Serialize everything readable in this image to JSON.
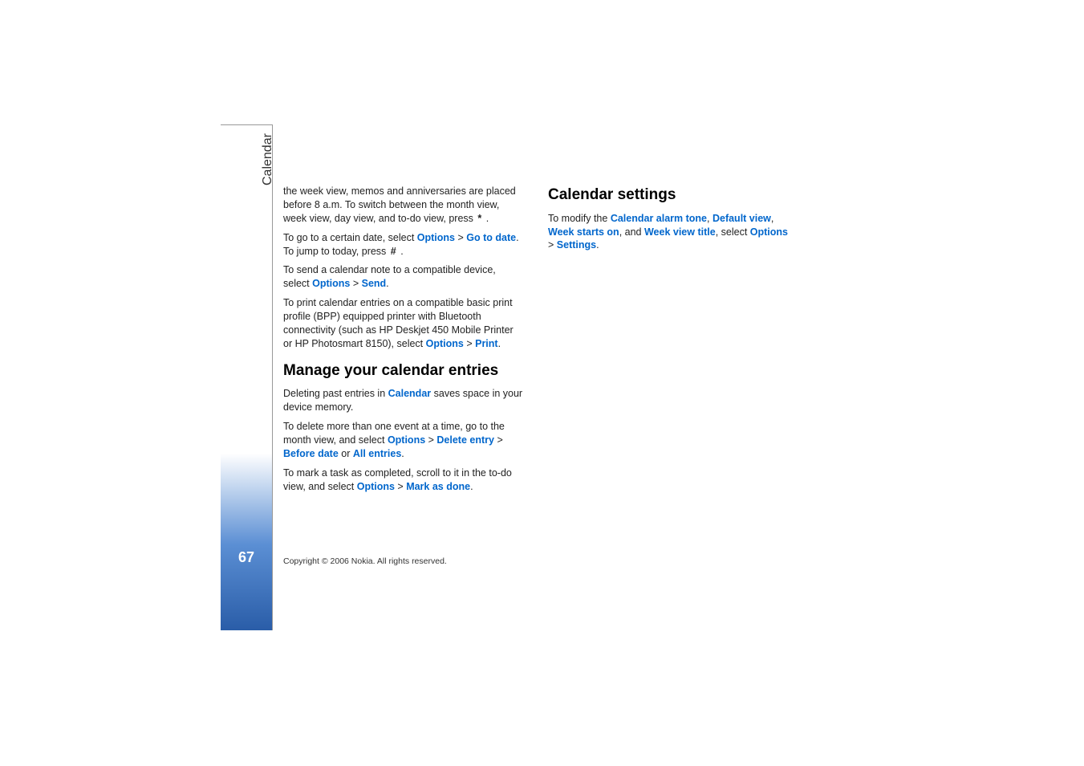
{
  "sidebar": {
    "label": "Calendar",
    "page_number": "67"
  },
  "col1": {
    "p1_a": "the week view, memos and anniversaries are placed before 8 a.m. To switch between the month view, week view, day view, and to-do view, press ",
    "p1_key": "*",
    "p1_b": " .",
    "p2_a": "To go to a certain date, select ",
    "p2_l1": "Options",
    "p2_gt": " > ",
    "p2_l2": "Go to date",
    "p2_b": ". To jump to today, press ",
    "p2_key": "#",
    "p2_c": " .",
    "p3_a": "To send a calendar note to a compatible device, select ",
    "p3_l1": "Options",
    "p3_gt": " > ",
    "p3_l2": "Send",
    "p3_b": ".",
    "p4_a": "To print calendar entries on a compatible basic print profile (BPP) equipped printer with Bluetooth connectivity (such as HP Deskjet 450 Mobile Printer or HP Photosmart 8150), select ",
    "p4_l1": "Options",
    "p4_gt": " > ",
    "p4_l2": "Print",
    "p4_b": ".",
    "h1": "Manage your calendar entries",
    "p5_a": "Deleting past entries in ",
    "p5_l1": "Calendar",
    "p5_b": " saves space in your device memory.",
    "p6_a": "To delete more than one event at a time, go to the month view, and select ",
    "p6_l1": "Options",
    "p6_gt1": " > ",
    "p6_l2": "Delete entry",
    "p6_gt2": " > ",
    "p6_l3": "Before date",
    "p6_b": " or ",
    "p6_l4": "All entries",
    "p6_c": ".",
    "p7_a": "To mark a task as completed, scroll to it in the to-do view, and select ",
    "p7_l1": "Options",
    "p7_gt": " > ",
    "p7_l2": "Mark as done",
    "p7_b": "."
  },
  "col2": {
    "h1": "Calendar settings",
    "p1_a": "To modify the ",
    "p1_l1": "Calendar alarm tone",
    "p1_s1": ", ",
    "p1_l2": "Default view",
    "p1_s2": ", ",
    "p1_l3": "Week starts on",
    "p1_s3": ", and ",
    "p1_l4": "Week view title",
    "p1_s4": ", select ",
    "p1_l5": "Options",
    "p1_gt": " > ",
    "p1_l6": "Settings",
    "p1_b": "."
  },
  "footer": {
    "copyright": "Copyright © 2006 Nokia. All rights reserved."
  }
}
